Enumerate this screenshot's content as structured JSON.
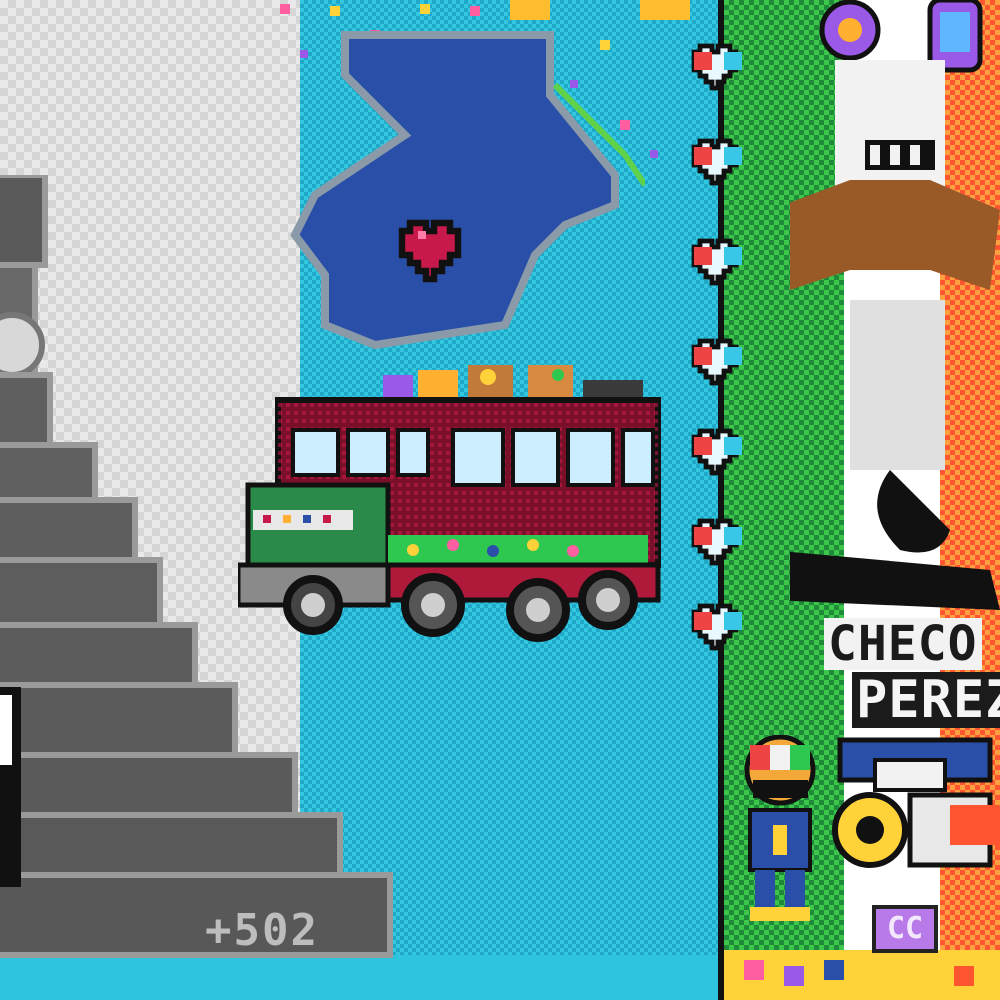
{
  "canvas": {
    "description_colors": {
      "left_bg": "#e9e9e9",
      "cyan": "#33c8e0",
      "green": "#3cc74a",
      "orange": "#ff5530",
      "map_blue": "#2a4fa8",
      "heart_red": "#c8194b",
      "bus_maroon": "#b01a3a"
    }
  },
  "pyramid": {
    "label": "+502"
  },
  "map": {
    "icon": "heart-icon"
  },
  "bus": {
    "icon": "chicken-bus"
  },
  "hearts_column": {
    "count": 7,
    "icon": "tricolor-heart-icon"
  },
  "tribute": {
    "line1": "CHECO",
    "line2": "PEREZ",
    "badge": "CC"
  }
}
